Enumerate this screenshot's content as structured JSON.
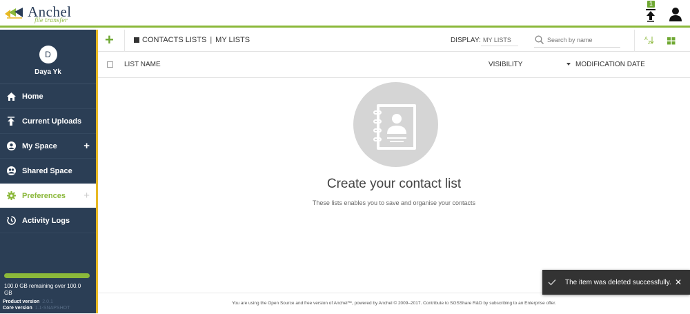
{
  "app": {
    "name": "Anchel",
    "tagline": "file transfer"
  },
  "header": {
    "upload_badge": "1",
    "upload_icon": "upload-icon",
    "user_icon": "user-icon"
  },
  "sidebar": {
    "avatar_initial": "D",
    "user_name": "Daya Yk",
    "items": [
      {
        "label": "Home",
        "icon": "home-icon"
      },
      {
        "label": "Current Uploads",
        "icon": "upload-icon"
      },
      {
        "label": "My Space",
        "icon": "user-circle-icon",
        "plus": "+"
      },
      {
        "label": "Shared Space",
        "icon": "group-icon"
      },
      {
        "label": "Preferences",
        "icon": "gear-icon",
        "plus": "+",
        "active": true
      },
      {
        "label": "Activity Logs",
        "icon": "history-icon"
      }
    ],
    "storage_fraction": 1.0,
    "storage_text": "100.0 GB remaining over 100.0 GB",
    "product_version_label": "Product version",
    "product_version": "2.0.1",
    "core_version_label": "Core version",
    "core_version": "1.1-SNAPSHOT"
  },
  "toolbar": {
    "add_label": "+",
    "crumb_contacts": "CONTACTS LISTS",
    "crumb_divider": "|",
    "crumb_current": "MY LISTS",
    "display_label": "DISPLAY:",
    "display_value": "MY LISTS",
    "search_placeholder": "Search by name"
  },
  "table": {
    "col_name": "LIST NAME",
    "col_visibility": "VISIBILITY",
    "col_modified": "MODIFICATION DATE"
  },
  "empty_state": {
    "title": "Create your contact list",
    "subtitle": "These lists enables you to save and organise your contacts"
  },
  "footer": {
    "text": "You are using the Open Source and free version of Anchel™, powered by Anchel © 2009–2017. Contribute to SGSShare R&D by subscribing to an Enterprise offer."
  },
  "toast": {
    "message": "The item was deleted successfully.",
    "close": "✕"
  },
  "colors": {
    "accent": "#8bb83a",
    "sidebar": "#2b3e55",
    "highlight": "#e8b923"
  }
}
